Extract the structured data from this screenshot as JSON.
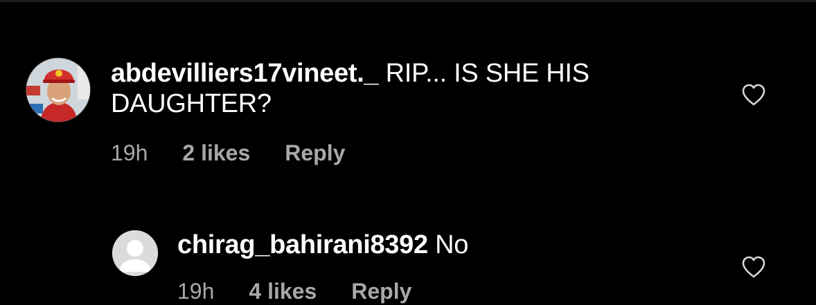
{
  "comments": [
    {
      "username": "abdevilliers17vineet._",
      "text": "RIP... IS SHE HIS DAUGHTER?",
      "time": "19h",
      "likes": "2 likes",
      "reply_label": "Reply"
    },
    {
      "username": "chirag_bahirani8392",
      "text": "No",
      "time": "19h",
      "likes": "4 likes",
      "reply_label": "Reply"
    }
  ],
  "icons": {
    "like": "heart-outline-icon",
    "default_avatar": "default-avatar-icon"
  },
  "colors": {
    "background": "#000000",
    "text": "#ffffff",
    "secondary_text": "#a8a8a8"
  }
}
